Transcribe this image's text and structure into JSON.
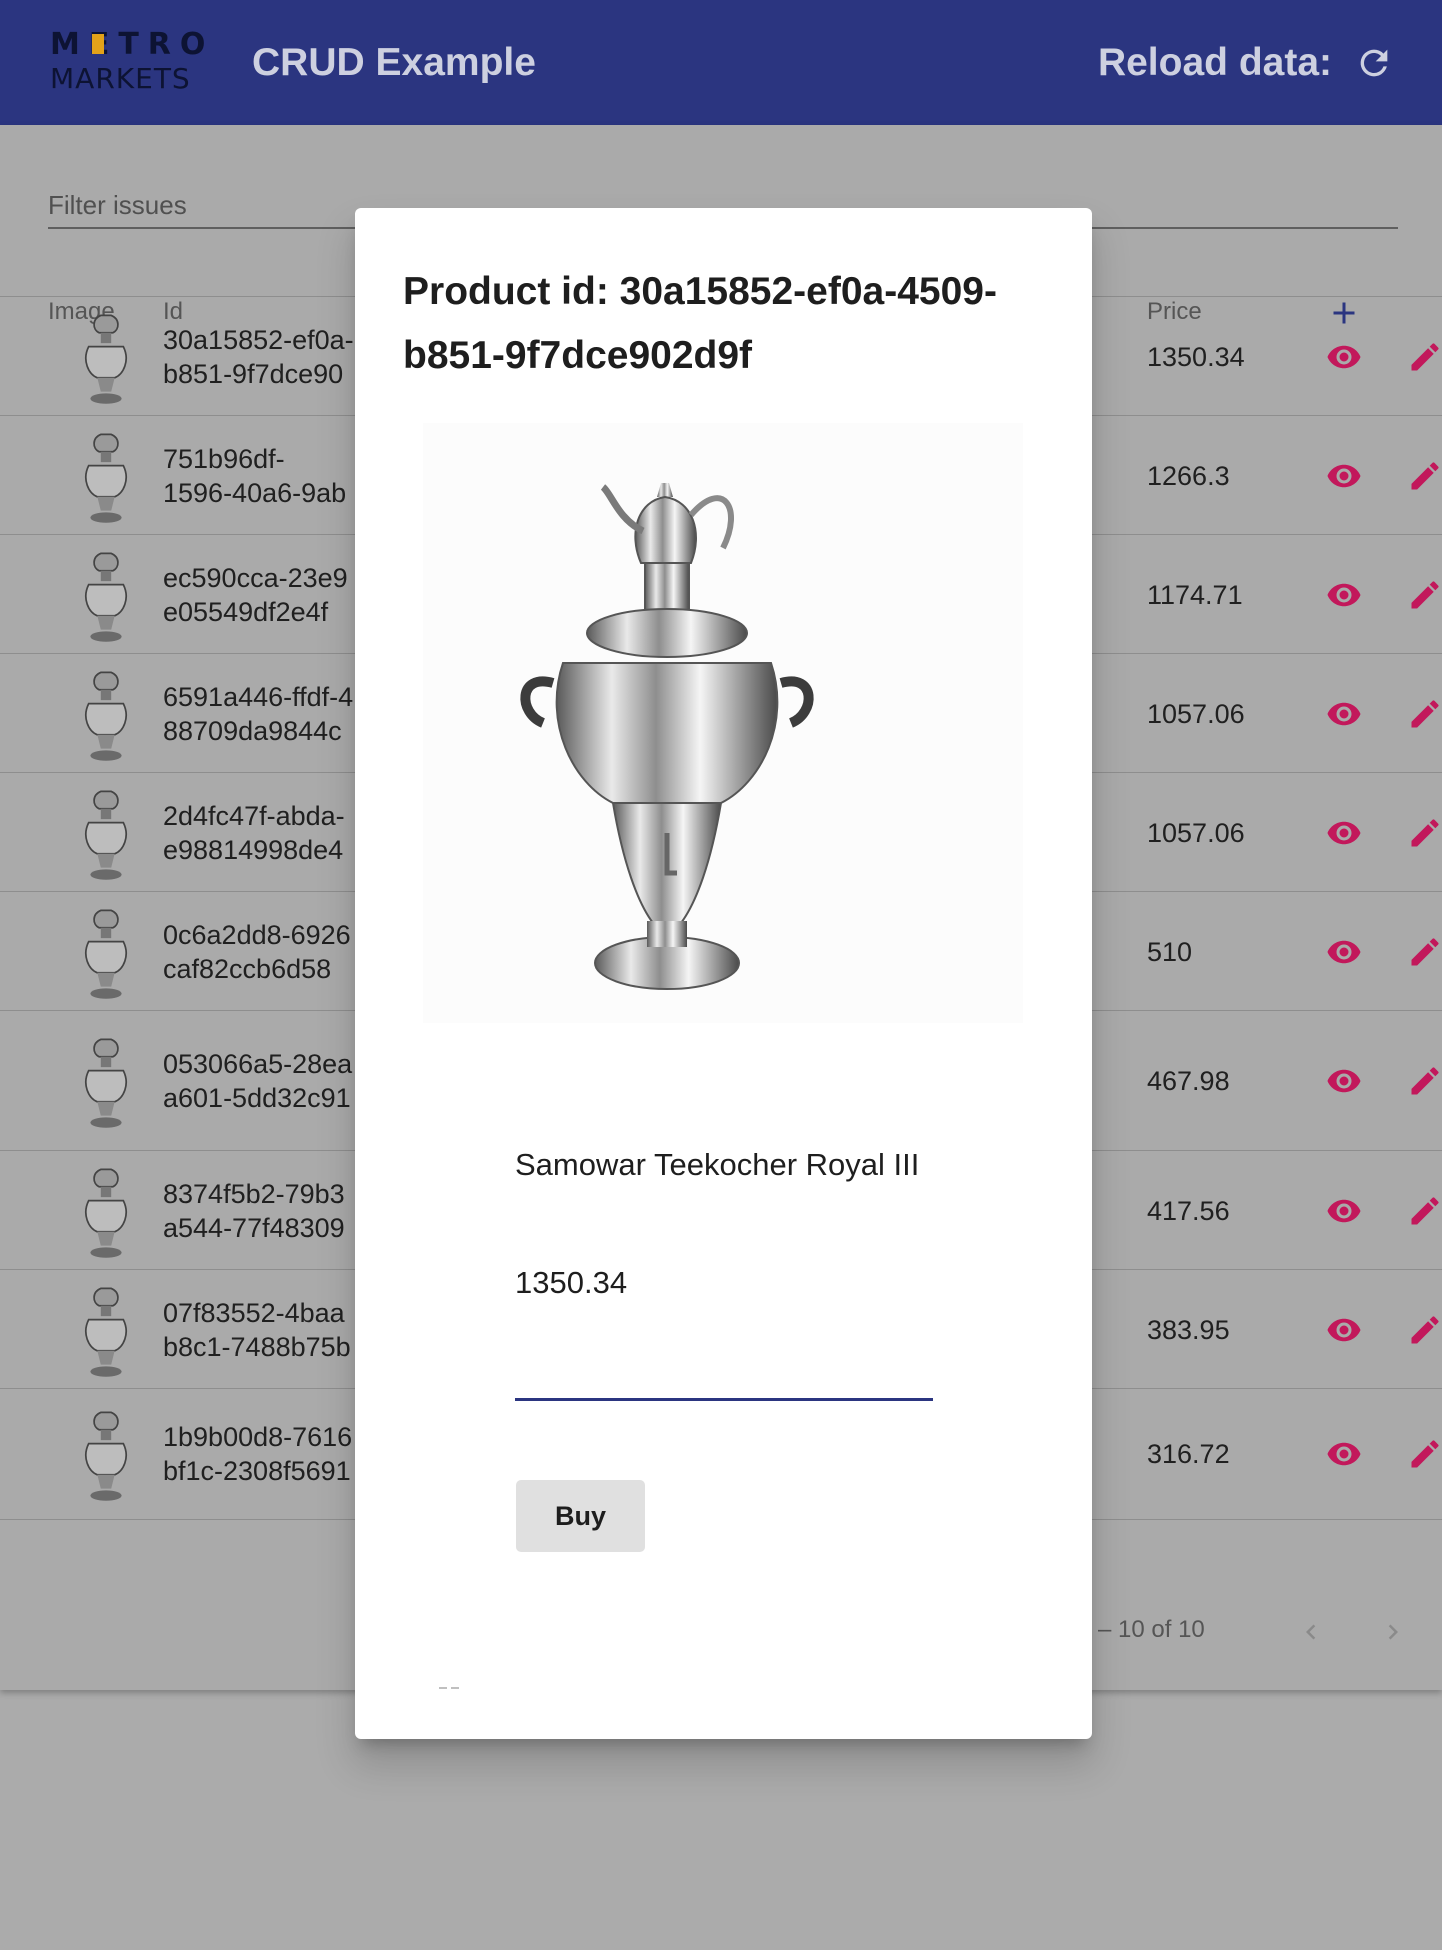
{
  "toolbar": {
    "logo_top": "METRO",
    "logo_bottom": "MARKETS",
    "title": "CRUD Example",
    "reload_label": "Reload data:",
    "reload_icon": "refresh-icon",
    "background_color": "#2b3580"
  },
  "table": {
    "filter_placeholder": "Filter issues",
    "columns": {
      "image": "Image",
      "id": "Id",
      "price": "Price"
    },
    "add_icon": "plus-icon",
    "rows": [
      {
        "id_line1": "30a15852-ef0a-",
        "id_line2": "b851-9f7dce90",
        "price": "1350.34"
      },
      {
        "id_line1": "751b96df-",
        "id_line2": "1596-40a6-9ab",
        "price": "1266.3"
      },
      {
        "id_line1": "ec590cca-23e9",
        "id_line2": "e05549df2e4f",
        "price": "1174.71"
      },
      {
        "id_line1": "6591a446-ffdf-4",
        "id_line2": "88709da9844c",
        "price": "1057.06"
      },
      {
        "id_line1": "2d4fc47f-abda-",
        "id_line2": "e98814998de4",
        "price": "1057.06"
      },
      {
        "id_line1": "0c6a2dd8-6926",
        "id_line2": "caf82ccb6d58",
        "price": "510"
      },
      {
        "id_line1": "053066a5-28ea",
        "id_line2": "a601-5dd32c91",
        "price": "467.98"
      },
      {
        "id_line1": "8374f5b2-79b3",
        "id_line2": "a544-77f48309",
        "price": "417.56"
      },
      {
        "id_line1": "07f83552-4baa",
        "id_line2": "b8c1-7488b75b",
        "price": "383.95"
      },
      {
        "id_line1": "1b9b00d8-7616",
        "id_line2": "bf1c-2308f5691",
        "price": "316.72"
      }
    ],
    "row_icons": {
      "view": "eye-icon",
      "edit": "pencil-icon"
    },
    "action_color": "#c2185b"
  },
  "pagination": {
    "range": "– 10 of 10",
    "prev_icon": "chevron-left-icon",
    "next_icon": "chevron-right-icon"
  },
  "modal": {
    "title": "Product id: 30a15852-ef0a-4509-b851-9f7dce902d9f",
    "image_icon": "samovar-image",
    "product_name": "Samowar Teekocher Royal III",
    "product_price": "1350.34",
    "quantity_value": "",
    "buy_label": "Buy",
    "accent_color": "#2b3580"
  }
}
